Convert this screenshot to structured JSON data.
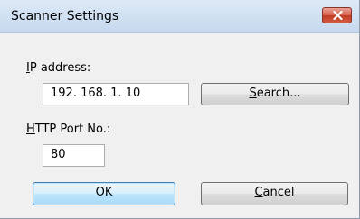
{
  "window": {
    "title": "Scanner Settings"
  },
  "ip_address": {
    "label_mnemonic": "I",
    "label_rest": "P address:",
    "value": "192. 168. 1. 10"
  },
  "search_button": {
    "label_mnemonic": "S",
    "label_rest": "earch..."
  },
  "http_port": {
    "label_mnemonic": "H",
    "label_rest": "TTP Port No.:",
    "value": "80"
  },
  "ok_button": {
    "label": "OK"
  },
  "cancel_button": {
    "label_mnemonic": "C",
    "label_rest": "ancel"
  },
  "icons": {
    "close": "close-x-icon"
  },
  "colors": {
    "close_button": "#c94a34",
    "default_button_border": "#3c7fb1",
    "titlebar": "#d2e2f3",
    "dialog_background": "#f0f0f0"
  }
}
